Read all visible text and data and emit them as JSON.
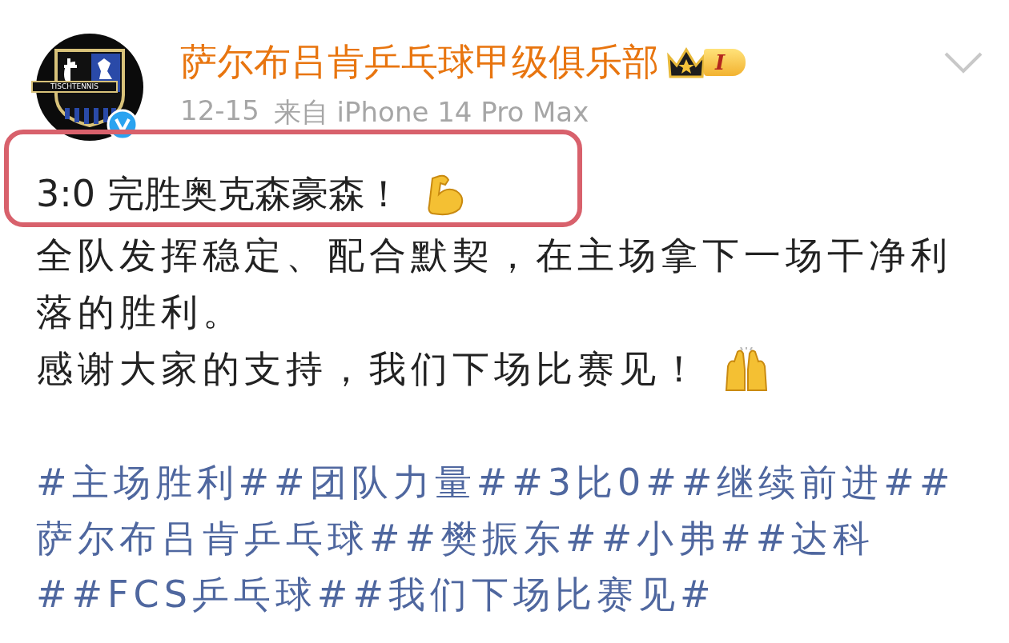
{
  "post": {
    "author": "萨尔布吕肯乒乓球甲级俱乐部",
    "avatar": {
      "logo_text": "TISCHTENNIS",
      "verified": true
    },
    "level_badge": "I",
    "meta": {
      "date": "12-15",
      "source": "来自 iPhone 14 Pro Max"
    },
    "headline": "3:0 完胜奥克森豪森！",
    "paragraphs": [
      "全队发挥稳定、配合默契，在主场拿下一场干净利落的胜利。",
      "感谢大家的支持，我们下场比赛见！"
    ],
    "hashtags": "#主场胜利##团队力量##3比0##继续前进##萨尔布吕肯乒乓球##樊振东##小弗##达科##FCS乒乓球##我们下场比赛见#"
  }
}
